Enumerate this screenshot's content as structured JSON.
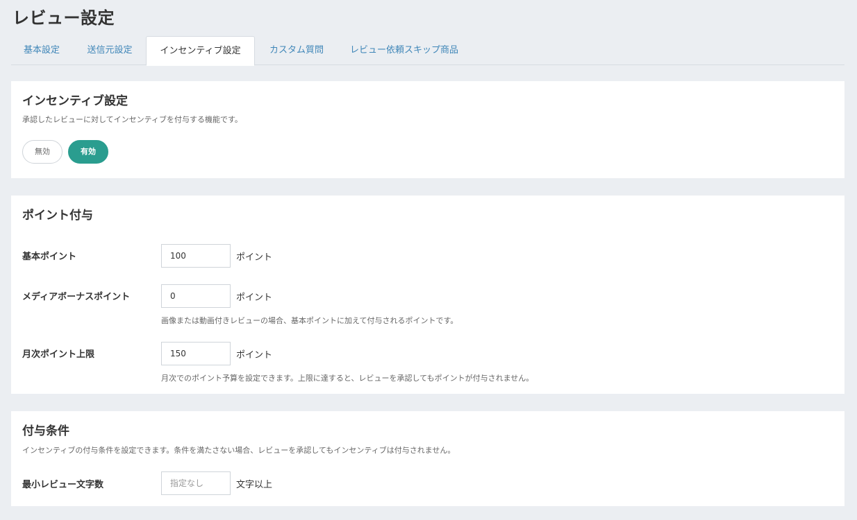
{
  "page": {
    "title": "レビュー設定"
  },
  "tabs": [
    {
      "label": "基本設定"
    },
    {
      "label": "送信元設定"
    },
    {
      "label": "インセンティブ設定"
    },
    {
      "label": "カスタム質問"
    },
    {
      "label": "レビュー依頼スキップ商品"
    }
  ],
  "active_tab": "インセンティブ設定",
  "incentive": {
    "title": "インセンティブ設定",
    "description": "承認したレビューに対してインセンティブを付与する機能です。",
    "toggle_off_label": "無効",
    "toggle_on_label": "有効",
    "selected": "有効"
  },
  "points": {
    "title": "ポイント付与",
    "fields": [
      {
        "label": "基本ポイント",
        "value": "100",
        "unit": "ポイント",
        "help": ""
      },
      {
        "label": "メディアボーナスポイント",
        "value": "0",
        "unit": "ポイント",
        "help": "画像または動画付きレビューの場合、基本ポイントに加えて付与されるポイントです。"
      },
      {
        "label": "月次ポイント上限",
        "value": "150",
        "unit": "ポイント",
        "help": "月次でのポイント予算を設定できます。上限に達すると、レビューを承認してもポイントが付与されません。"
      }
    ]
  },
  "conditions": {
    "title": "付与条件",
    "description": "インセンティブの付与条件を設定できます。条件を満たさない場合、レビューを承認してもインセンティブは付与されません。",
    "fields": [
      {
        "label": "最小レビュー文字数",
        "value": "",
        "placeholder": "指定なし",
        "unit": "文字以上"
      }
    ]
  },
  "colors": {
    "accent": "#2a9d8f",
    "tab_link": "#3f86b8",
    "background": "#ebeef2"
  }
}
